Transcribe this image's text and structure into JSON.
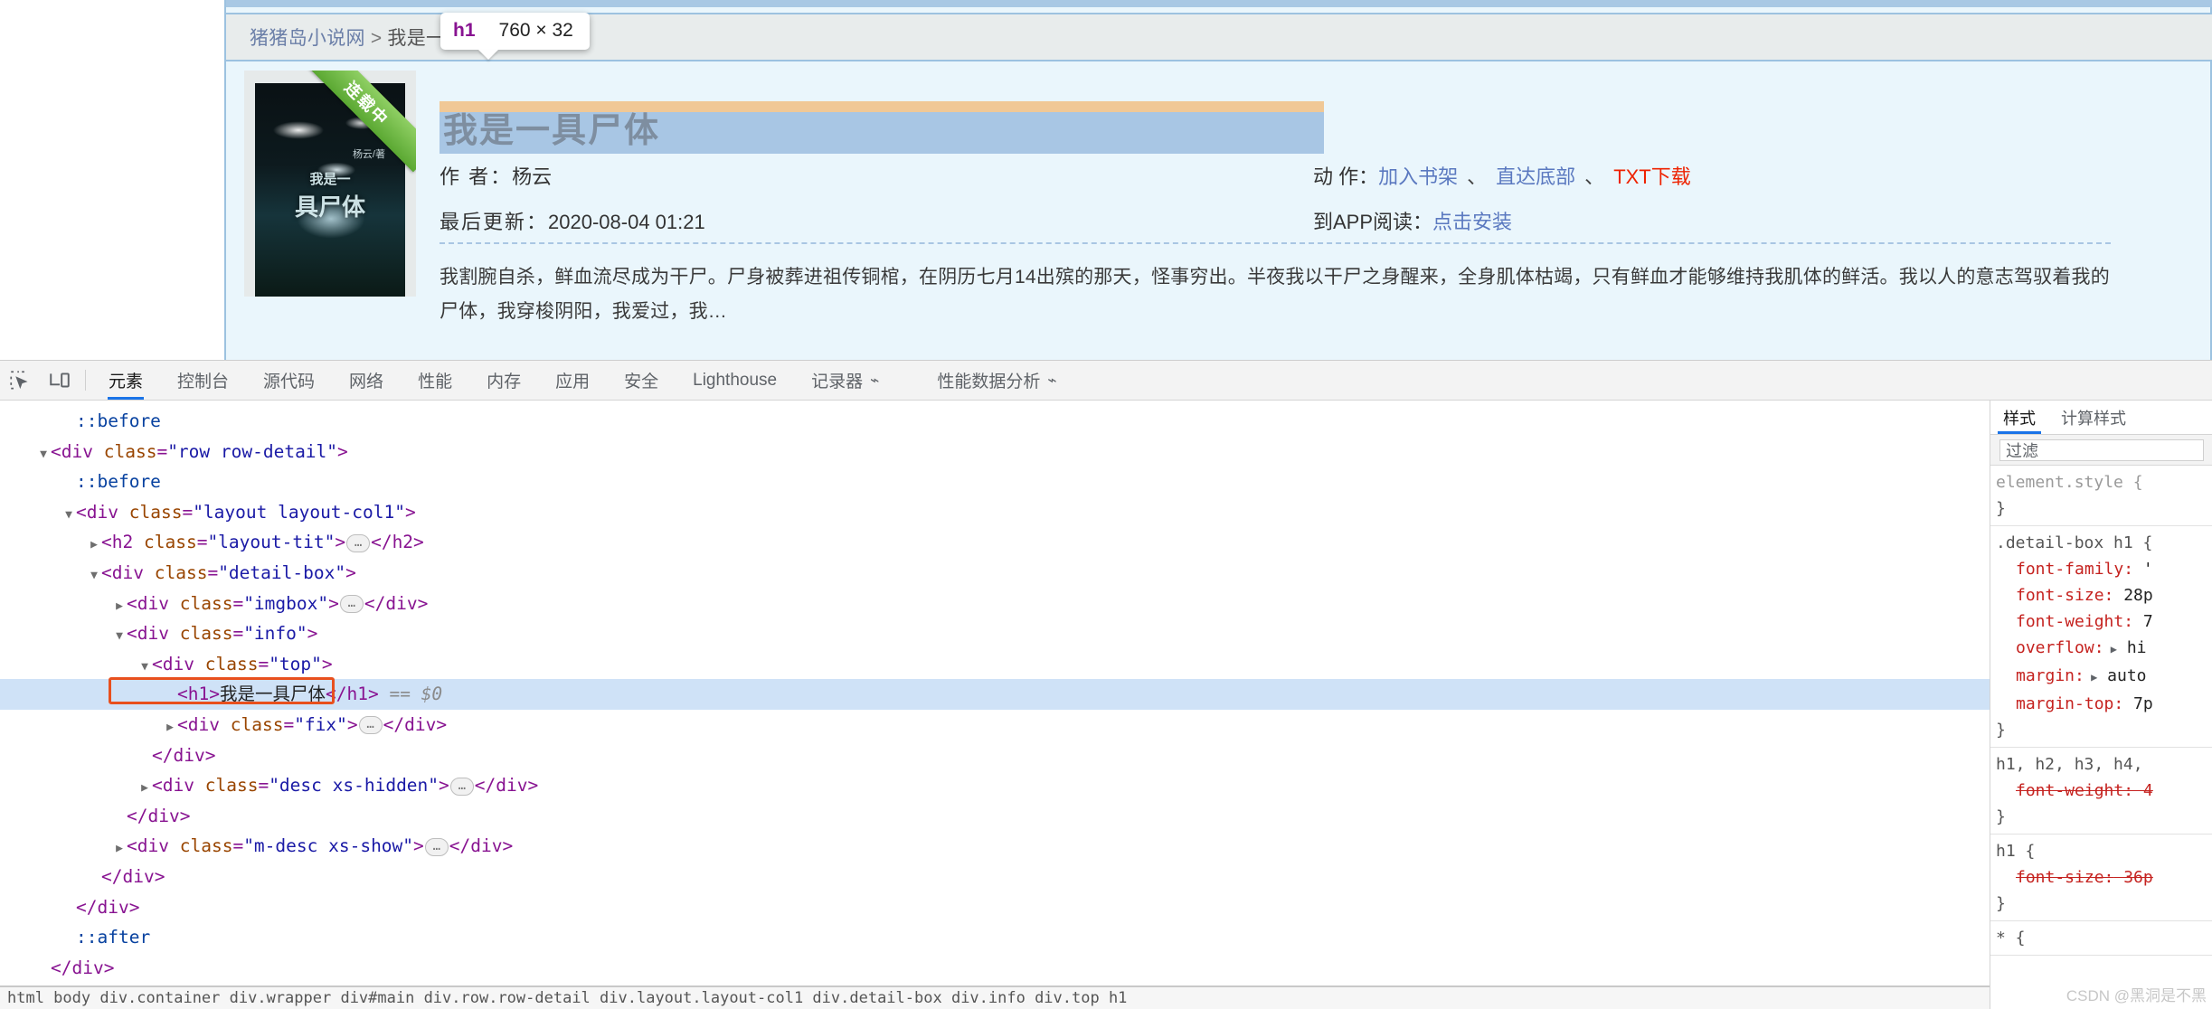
{
  "page": {
    "breadcrumb": {
      "site": "猪猪岛小说网",
      "separator": ">",
      "current": "我是一具尸体最新"
    },
    "cover": {
      "ribbon_label": "连载中",
      "title_line1": "我是一",
      "title_line2": "具尸体",
      "author_mark": "杨云/著"
    },
    "book": {
      "title": "我是一具尸体",
      "author_label": "作 者：",
      "author_value": "杨云",
      "updated_label": "最后更新：",
      "updated_value": "2020-08-04 01:21",
      "action_label": "动 作：",
      "actions": [
        "加入书架",
        "直达底部",
        "TXT下载"
      ],
      "app_label": "到APP阅读：",
      "app_action": "点击安装",
      "separator": "、",
      "description": "我割腕自杀，鲜血流尽成为干尸。尸身被葬进祖传铜棺，在阴历七月14出殡的那天，怪事穷出。半夜我以干尸之身醒来，全身肌体枯竭，只有鲜血才能够维持我肌体的鲜活。我以人的意志驾驭着我的尸体，我穿梭阴阳，我爱过，我…"
    },
    "inspector_tooltip": {
      "tag": "h1",
      "dimensions": "760 × 32"
    }
  },
  "devtools": {
    "toolbar": {
      "inspect_icon": "inspect-cursor-icon",
      "device_icon": "device-toolbar-icon",
      "tabs": [
        {
          "label": "元素",
          "active": true,
          "beaker": false
        },
        {
          "label": "控制台",
          "active": false,
          "beaker": false
        },
        {
          "label": "源代码",
          "active": false,
          "beaker": false
        },
        {
          "label": "网络",
          "active": false,
          "beaker": false
        },
        {
          "label": "性能",
          "active": false,
          "beaker": false
        },
        {
          "label": "内存",
          "active": false,
          "beaker": false
        },
        {
          "label": "应用",
          "active": false,
          "beaker": false
        },
        {
          "label": "安全",
          "active": false,
          "beaker": false
        },
        {
          "label": "Lighthouse",
          "active": false,
          "beaker": false
        },
        {
          "label": "记录器",
          "active": false,
          "beaker": true
        },
        {
          "label": "性能数据分析",
          "active": false,
          "beaker": true
        }
      ]
    },
    "dom_tree": [
      {
        "indent": 1,
        "twisty": "none",
        "kind": "pseudo",
        "text": "::before"
      },
      {
        "indent": 0,
        "twisty": "expanded",
        "kind": "open",
        "tag": "div",
        "attr": "class",
        "value": "row row-detail"
      },
      {
        "indent": 1,
        "twisty": "none",
        "kind": "pseudo",
        "text": "::before"
      },
      {
        "indent": 1,
        "twisty": "expanded",
        "kind": "open",
        "tag": "div",
        "attr": "class",
        "value": "layout layout-col1"
      },
      {
        "indent": 2,
        "twisty": "collapsed",
        "kind": "collapsed",
        "tag": "h2",
        "attr": "class",
        "value": "layout-tit"
      },
      {
        "indent": 2,
        "twisty": "expanded",
        "kind": "open",
        "tag": "div",
        "attr": "class",
        "value": "detail-box"
      },
      {
        "indent": 3,
        "twisty": "collapsed",
        "kind": "collapsed",
        "tag": "div",
        "attr": "class",
        "value": "imgbox"
      },
      {
        "indent": 3,
        "twisty": "expanded",
        "kind": "open",
        "tag": "div",
        "attr": "class",
        "value": "info"
      },
      {
        "indent": 4,
        "twisty": "expanded",
        "kind": "open",
        "tag": "div",
        "attr": "class",
        "value": "top"
      },
      {
        "indent": 5,
        "twisty": "none",
        "kind": "selected",
        "tag": "h1",
        "text": "我是一具尸体",
        "suffix": "== $0"
      },
      {
        "indent": 5,
        "twisty": "collapsed",
        "kind": "collapsed",
        "tag": "div",
        "attr": "class",
        "value": "fix"
      },
      {
        "indent": 4,
        "twisty": "none",
        "kind": "close",
        "tag": "div"
      },
      {
        "indent": 4,
        "twisty": "collapsed",
        "kind": "collapsed",
        "tag": "div",
        "attr": "class",
        "value": "desc xs-hidden"
      },
      {
        "indent": 3,
        "twisty": "none",
        "kind": "close",
        "tag": "div"
      },
      {
        "indent": 3,
        "twisty": "collapsed",
        "kind": "collapsed",
        "tag": "div",
        "attr": "class",
        "value": "m-desc xs-show"
      },
      {
        "indent": 2,
        "twisty": "none",
        "kind": "close",
        "tag": "div"
      },
      {
        "indent": 1,
        "twisty": "none",
        "kind": "close",
        "tag": "div"
      },
      {
        "indent": 1,
        "twisty": "none",
        "kind": "pseudo",
        "text": "::after"
      },
      {
        "indent": 0,
        "twisty": "none",
        "kind": "close",
        "tag": "div"
      }
    ],
    "dom_breadcrumb": "html body div.container div.wrapper div#main div.row.row-detail div.layout.layout-col1 div.detail-box div.info div.top h1",
    "styles": {
      "tabs": [
        {
          "label": "样式",
          "active": true
        },
        {
          "label": "计算样式",
          "active": false
        }
      ],
      "filter_placeholder": "过滤",
      "rules": [
        {
          "selector": "element.style {",
          "close": "}",
          "declarations": []
        },
        {
          "selector": ".detail-box h1 {",
          "close": "}",
          "declarations": [
            {
              "prop": "font-family:",
              "value": " '",
              "struck": false,
              "arrow": false
            },
            {
              "prop": "font-size:",
              "value": " 28p",
              "struck": false,
              "arrow": false
            },
            {
              "prop": "font-weight:",
              "value": " 7",
              "struck": false,
              "arrow": false
            },
            {
              "prop": "overflow:",
              "value": " hi",
              "struck": false,
              "arrow": true
            },
            {
              "prop": "margin:",
              "value": " auto",
              "struck": false,
              "arrow": true
            },
            {
              "prop": "margin-top:",
              "value": " 7p",
              "struck": false,
              "arrow": false
            }
          ]
        },
        {
          "selector": "h1, h2, h3, h4,",
          "close": "}",
          "declarations": [
            {
              "prop": "font-weight:",
              "value": " 4",
              "struck": true,
              "arrow": false
            }
          ]
        },
        {
          "selector": "h1 {",
          "close": "}",
          "declarations": [
            {
              "prop": "font-size:",
              "value": " 36p",
              "struck": true,
              "arrow": false
            }
          ]
        },
        {
          "selector": "* {",
          "close": "",
          "declarations": []
        }
      ],
      "watermark": "CSDN @黑洞是不黑"
    }
  }
}
